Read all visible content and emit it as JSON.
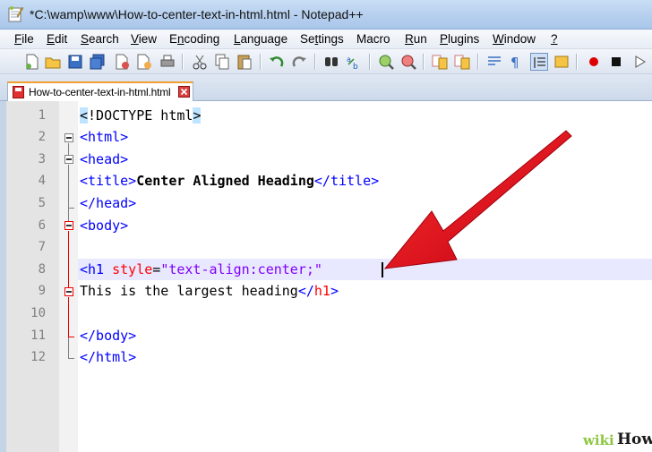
{
  "window": {
    "title": "*C:\\wamp\\www\\How-to-center-text-in-html.html - Notepad++"
  },
  "menu": {
    "file": "F",
    "file_rest": "ile",
    "edit": "E",
    "edit_rest": "dit",
    "search": "S",
    "search_rest": "earch",
    "view": "V",
    "view_rest": "iew",
    "encoding_pre": "E",
    "encoding_mn": "n",
    "encoding_rest": "coding",
    "language": "L",
    "language_rest": "anguage",
    "settings_pre": "Se",
    "settings_mn": "t",
    "settings_rest": "tings",
    "macro": "Macro",
    "run": "R",
    "run_rest": "un",
    "plugins": "P",
    "plugins_rest": "lugins",
    "window": "W",
    "window_rest": "indow",
    "help": "?"
  },
  "tab": {
    "label": "How-to-center-text-in-html.html"
  },
  "editor": {
    "line_numbers": [
      "1",
      "2",
      "3",
      "4",
      "5",
      "6",
      "7",
      "8",
      "9",
      "10",
      "11",
      "12"
    ],
    "code": {
      "l1a": "<",
      "l1b": "!DOCTYPE html",
      "l1c": ">",
      "l2": "<html>",
      "l3": "<head>",
      "l4a": "<title>",
      "l4b": "Center Aligned Heading",
      "l4c": "</title>",
      "l5": "</head>",
      "l6": "<body>",
      "l8a": "<h1 ",
      "l8b": "style",
      "l8c": "=",
      "l8d": "\"text-align:center;\"",
      "l9a": "This is the largest heading",
      "l9b": "</",
      "l9c": "h1",
      "l9d": ">",
      "l11": "</body>",
      "l12": "</html>"
    }
  },
  "watermark": {
    "wiki": "wiki",
    "how": "How"
  },
  "colors": {
    "tag": "#0000ff",
    "attr": "#ff0000",
    "string": "#8000ff",
    "arrow": "#e8101c"
  }
}
